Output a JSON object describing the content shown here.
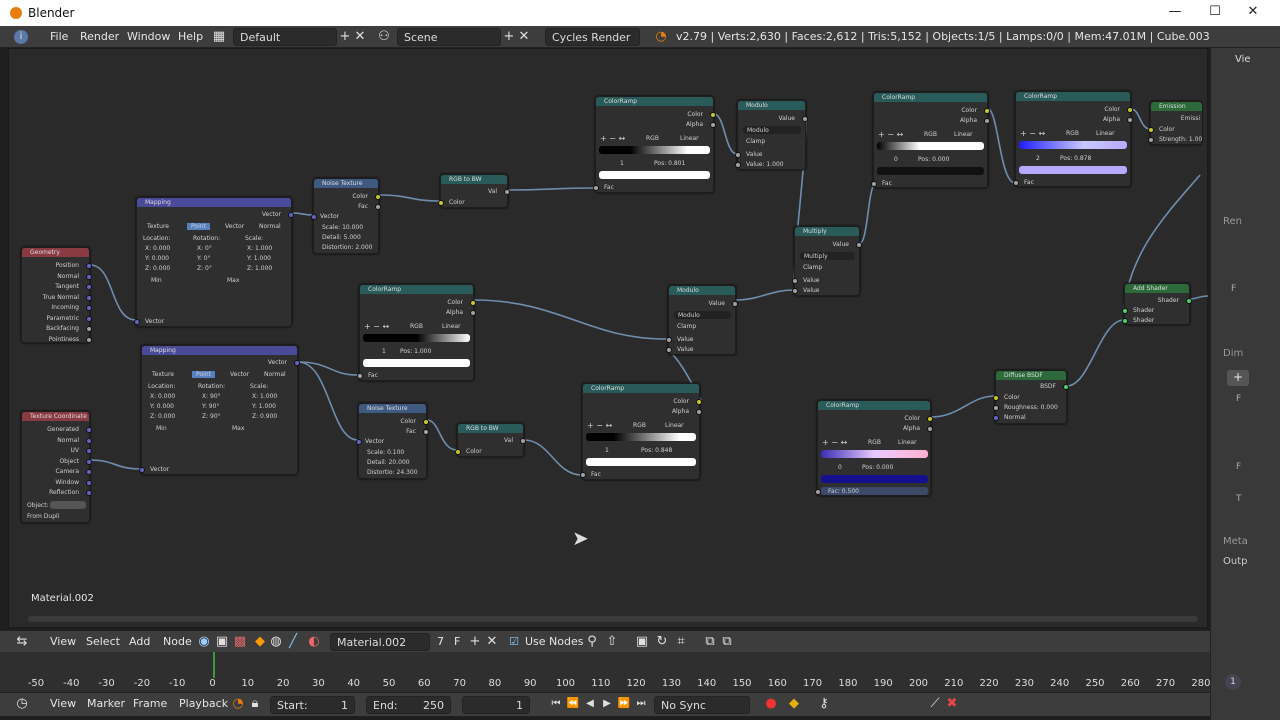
{
  "window": {
    "title": "Blender",
    "minimize": "—",
    "maximize": "☐",
    "close": "✕"
  },
  "info": {
    "menus": [
      "File",
      "Render",
      "Window",
      "Help"
    ],
    "layout": "Default",
    "scene": "Scene",
    "engine": "Cycles Render",
    "stats": "v2.79 | Verts:2,630 | Faces:2,612 | Tris:5,152 | Objects:1/5 | Lamps:0/0 | Mem:47.01M | Cube.003"
  },
  "canvas": {
    "material_label": "Material.002"
  },
  "nodes": {
    "geometry": {
      "title": "Geometry",
      "outs": [
        "Position",
        "Normal",
        "Tangent",
        "True Normal",
        "Incoming",
        "Parametric",
        "Backfacing",
        "Pointiness"
      ]
    },
    "texcoord": {
      "title": "Texture Coordinate",
      "outs": [
        "Generated",
        "Normal",
        "UV",
        "Object",
        "Camera",
        "Window",
        "Reflection"
      ],
      "object": "Object:",
      "dupli": "From Dupli"
    },
    "mapping1": {
      "title": "Mapping",
      "out": "Vector",
      "tabs": [
        "Texture",
        "Point",
        "Vector",
        "Normal"
      ],
      "heads": [
        "Location:",
        "Rotation:",
        "Scale:"
      ],
      "loc": [
        "X:   0.000",
        "Y:   0.000",
        "Z:   0.000"
      ],
      "rot": [
        "X:   0°",
        "Y:   0°",
        "Z:   0°"
      ],
      "scale": [
        "X:   1.000",
        "Y:   1.000",
        "Z:   1.000"
      ],
      "min": "Min",
      "max": "Max",
      "in": "Vector"
    },
    "mapping2": {
      "title": "Mapping",
      "out": "Vector",
      "tabs": [
        "Texture",
        "Point",
        "Vector",
        "Normal"
      ],
      "heads": [
        "Location:",
        "Rotation:",
        "Scale:"
      ],
      "loc": [
        "X:   0.000",
        "Y:   0.000",
        "Z:   0.000"
      ],
      "rot": [
        "X:   90°",
        "Y:   90°",
        "Z:   90°"
      ],
      "scale": [
        "X:   1.000",
        "Y:   1.000",
        "Z:   0.900"
      ],
      "min": "Min",
      "max": "Max",
      "in": "Vector"
    },
    "noise1": {
      "title": "Noise Texture",
      "outs": [
        "Color",
        "Fac"
      ],
      "in": "Vector",
      "vals": [
        "Scale:  10.000",
        "Detail:  5.000",
        "Distortion: 2.000"
      ]
    },
    "noise2": {
      "title": "Noise Texture",
      "outs": [
        "Color",
        "Fac"
      ],
      "in": "Vector",
      "vals": [
        "Scale:  0.100",
        "Detail:  20.000",
        "Distortio: 24.300"
      ]
    },
    "rgbbw1": {
      "title": "RGB to BW",
      "out": "Val",
      "in": "Color"
    },
    "rgbbw2": {
      "title": "RGB to BW",
      "out": "Val",
      "in": "Color"
    },
    "cr1": {
      "title": "ColorRamp",
      "outs": [
        "Color",
        "Alpha"
      ],
      "mode": "RGB",
      "interp": "Linear",
      "idx": "1",
      "pos": "Pos:  0.801",
      "in": "Fac"
    },
    "cr2": {
      "title": "ColorRamp",
      "outs": [
        "Color",
        "Alpha"
      ],
      "mode": "RGB",
      "interp": "Linear",
      "idx": "1",
      "pos": "Pos:  1.000",
      "in": "Fac"
    },
    "cr3": {
      "title": "ColorRamp",
      "outs": [
        "Color",
        "Alpha"
      ],
      "mode": "RGB",
      "interp": "Linear",
      "idx": "1",
      "pos": "Pos:  0.848",
      "in": "Fac"
    },
    "cr4": {
      "title": "ColorRamp",
      "outs": [
        "Color",
        "Alpha"
      ],
      "mode": "RGB",
      "interp": "Linear",
      "idx": "0",
      "pos": "Pos:  0.000",
      "in": "Fac"
    },
    "cr5": {
      "title": "ColorRamp",
      "outs": [
        "Color",
        "Alpha"
      ],
      "mode": "RGB",
      "interp": "Linear",
      "idx": "2",
      "pos": "Pos:  0.878",
      "in": "Fac"
    },
    "cr6": {
      "title": "ColorRamp",
      "outs": [
        "Color",
        "Alpha"
      ],
      "mode": "RGB",
      "interp": "Linear",
      "idx": "0",
      "pos": "Pos:  0.000",
      "fac": "Fac:  0.500"
    },
    "mod1": {
      "title": "Modulo",
      "out": "Value",
      "op": "Modulo",
      "clamp": "Clamp",
      "ins": [
        "Value",
        "Value:  1.000"
      ]
    },
    "mod2": {
      "title": "Modulo",
      "out": "Value",
      "op": "Modulo",
      "clamp": "Clamp",
      "ins": [
        "Value",
        "Value"
      ]
    },
    "mult": {
      "title": "Multiply",
      "out": "Value",
      "op": "Multiply",
      "clamp": "Clamp",
      "ins": [
        "Value",
        "Value"
      ]
    },
    "diffuse": {
      "title": "Diffuse BSDF",
      "out": "BSDF",
      "ins": [
        "Color",
        "Roughness: 0.000",
        "Normal"
      ]
    },
    "addsh": {
      "title": "Add Shader",
      "out": "Shader",
      "ins": [
        "Shader",
        "Shader"
      ]
    },
    "emission": {
      "title": "Emission",
      "out": "Emissi",
      "ins": [
        "Color",
        "Strength: 1.00"
      ]
    }
  },
  "nodehdr": {
    "menus": [
      "View",
      "Select",
      "Add",
      "Node"
    ],
    "material": "Material.002",
    "users": "7",
    "fake": "F",
    "use_nodes": "Use Nodes"
  },
  "ruler": [
    "-50",
    "-40",
    "-30",
    "-20",
    "-10",
    "0",
    "10",
    "20",
    "30",
    "40",
    "50",
    "60",
    "70",
    "80",
    "90",
    "100",
    "110",
    "120",
    "130",
    "140",
    "150",
    "160",
    "170",
    "180",
    "190",
    "200",
    "210",
    "220",
    "230",
    "240",
    "250",
    "260",
    "270",
    "280"
  ],
  "playbar": {
    "menus": [
      "View",
      "Marker",
      "Frame",
      "Playback"
    ],
    "start": "Start:",
    "start_val": "1",
    "end": "End:",
    "end_val": "250",
    "current": "1",
    "sync": "No Sync"
  },
  "rpanel": {
    "tab": "Vie",
    "labels": [
      "Ren",
      "Dim",
      "Meta",
      "Outp",
      "F",
      "F",
      "F",
      "T"
    ],
    "num": "1"
  },
  "colors": {
    "accent": "#e87d0d",
    "wire": "#7aa0c8"
  }
}
